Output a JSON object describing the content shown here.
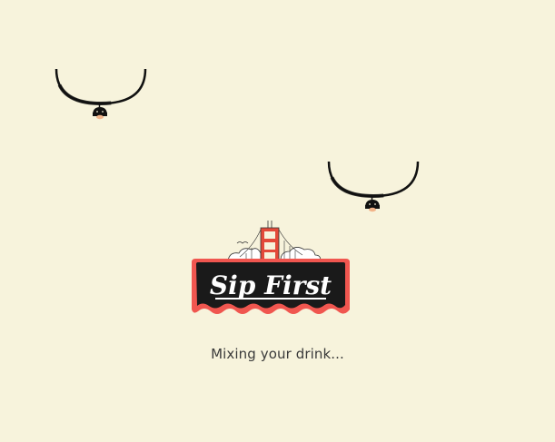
{
  "logo": {
    "text": "Sip First",
    "colors": {
      "banner_fill": "#1a1a1a",
      "banner_border": "#f0564f",
      "bridge": "#e34a3a",
      "text": "#ffffff"
    }
  },
  "status": {
    "text": "Mixing your drink..."
  },
  "decorations": {
    "swing_icon": "hanging-bat-swing-icon",
    "background": "#f7f3dc"
  }
}
